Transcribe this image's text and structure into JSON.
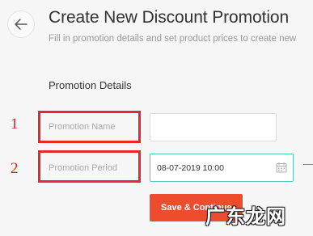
{
  "header": {
    "title": "Create New Discount Promotion",
    "subtitle": "Fill in promotion details and set product prices to create new"
  },
  "section": {
    "title": "Promotion Details"
  },
  "annotations": {
    "step1": "1",
    "step2": "2"
  },
  "form": {
    "name_label": "Promotion Name",
    "name_value": "",
    "period_label": "Promotion Period",
    "period_start": "08-07-2019 10:00"
  },
  "actions": {
    "save_label": "Save & Continue"
  },
  "watermark": {
    "text": "广东龙网"
  },
  "colors": {
    "accent": "#ee4d2d",
    "annotation_red": "#e8262c",
    "focus": "#5ac8b8"
  }
}
